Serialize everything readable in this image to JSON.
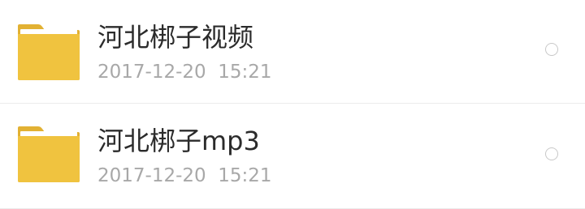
{
  "files": [
    {
      "name": "河北梆子视频",
      "date": "2017-12-20  15:21",
      "icon": "folder-icon"
    },
    {
      "name": "河北梆子mp3",
      "date": "2017-12-20  15:21",
      "icon": "folder-icon"
    }
  ],
  "colors": {
    "folder_body": "#F0C33F",
    "folder_tab": "#E2B133",
    "folder_sheet": "#FFFFFF",
    "title_text": "#2B2B2B",
    "meta_text": "#A8A8A8",
    "radio_border": "#C8C8C8",
    "divider": "#ECECEC"
  }
}
